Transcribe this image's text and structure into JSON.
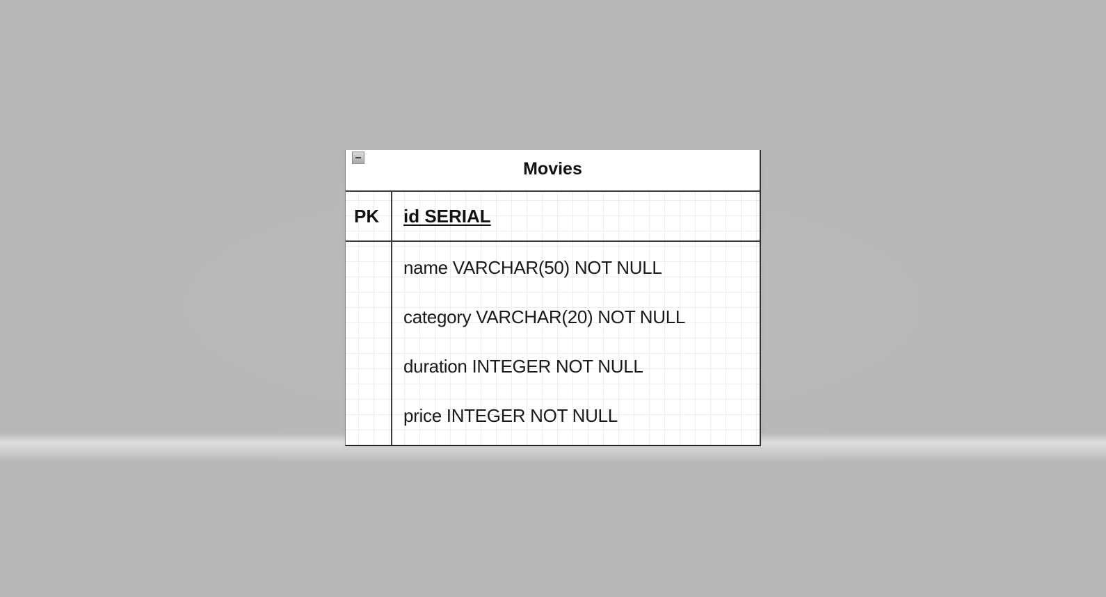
{
  "entity": {
    "title": "Movies",
    "collapse_icon": "minus-box-icon",
    "primary_key": {
      "label": "PK",
      "field": "id SERIAL"
    },
    "fields": [
      "name VARCHAR(50) NOT NULL",
      "category VARCHAR(20) NOT NULL",
      "duration INTEGER NOT NULL",
      "price INTEGER NOT NULL"
    ]
  }
}
